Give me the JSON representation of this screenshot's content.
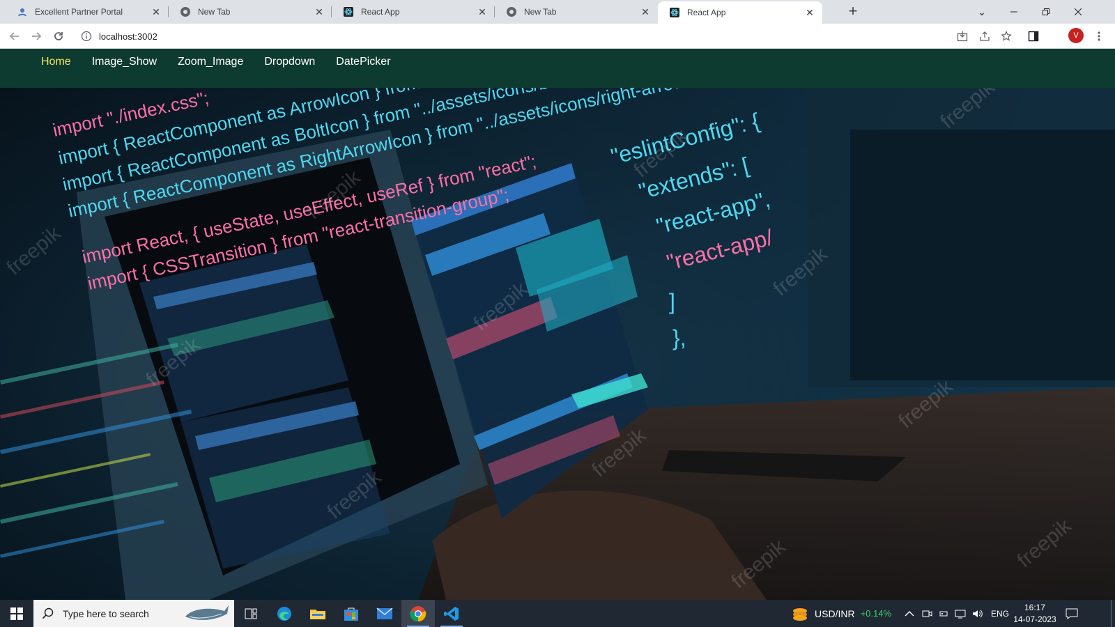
{
  "browser": {
    "tabs": [
      {
        "title": "Excellent Partner Portal",
        "active": false
      },
      {
        "title": "New Tab",
        "active": false
      },
      {
        "title": "React App",
        "active": false
      },
      {
        "title": "New Tab",
        "active": false
      },
      {
        "title": "React App",
        "active": true
      }
    ],
    "url": "localhost:3002",
    "avatar_letter": "V"
  },
  "navbar": {
    "items": [
      "Home",
      "Image_Show",
      "Zoom_Image",
      "Dropdown",
      "DatePicker"
    ],
    "active_item": "Home",
    "background": "#0e3b30",
    "active_color": "#f4e65c"
  },
  "hero": {
    "code_lines": [
      "import \"./index.css\";",
      "import { ReactComponent as ArrowIcon } from \"../assets/icons/arrow.svg\";",
      "import { ReactComponent as BoltIcon } from \"../assets/icons/bolt.svg\";",
      "import { ReactComponent as RightArrowIcon } from \"../assets/icons/right-arrow.svg\";",
      "import React, { useState, useEffect, useRef } from \"react\";",
      "import { CSSTransition } from \"react-transition-group\";"
    ],
    "eslint_lines": [
      "\"eslintConfig\": {",
      "\"extends\": [",
      "\"react-app\",",
      "\"react-app/",
      "]",
      "},"
    ],
    "watermark": "freepik"
  },
  "taskbar": {
    "search_placeholder": "Type here to search",
    "ticker_label": "USD/INR",
    "ticker_change": "+0.14%",
    "language": "ENG",
    "time": "16:17",
    "date": "14-07-2023"
  }
}
